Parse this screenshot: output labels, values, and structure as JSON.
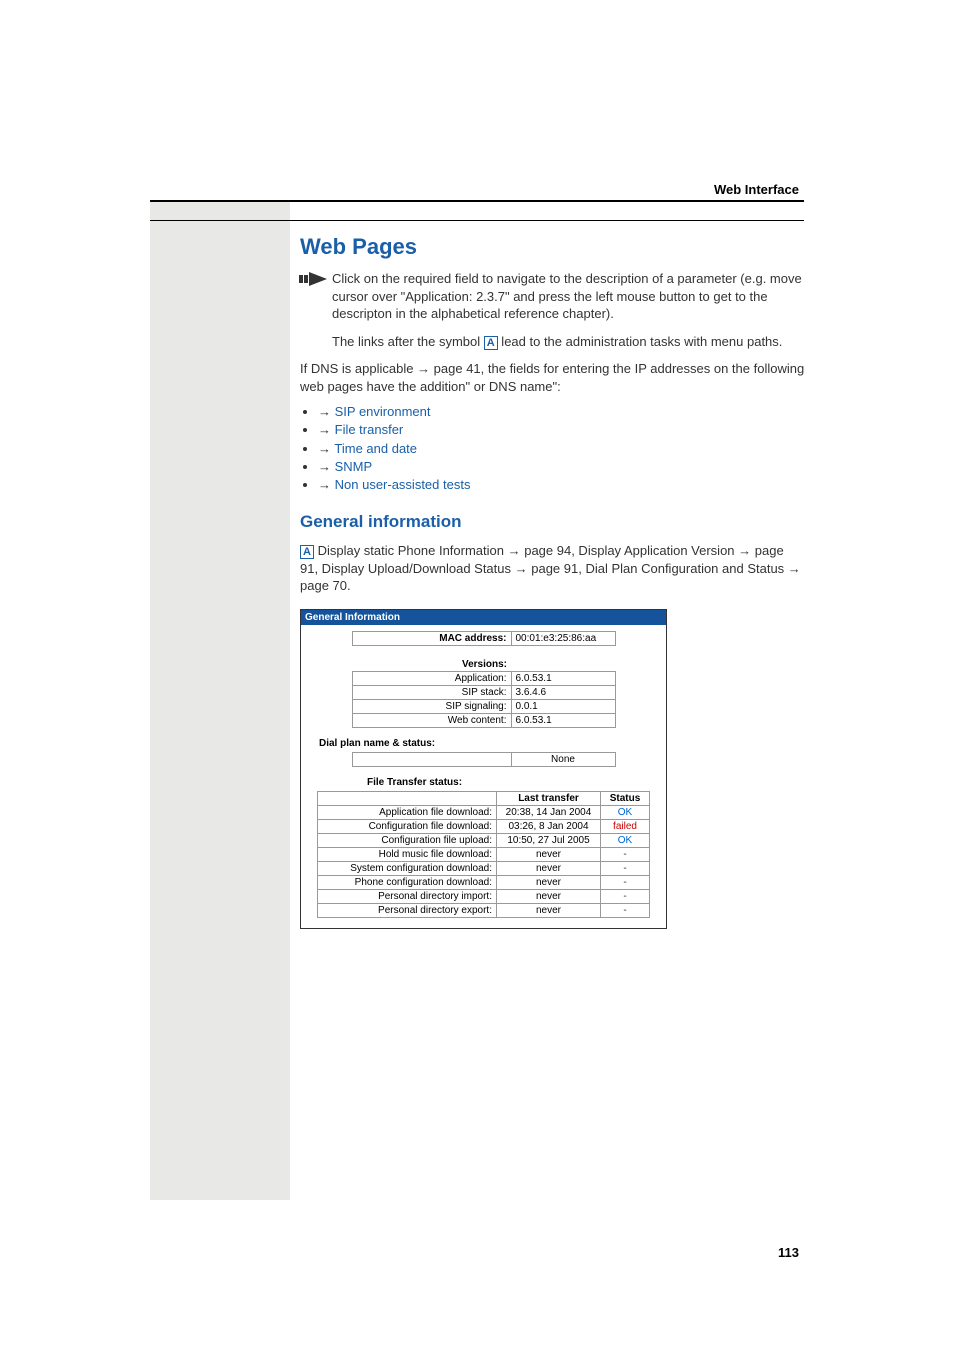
{
  "header": {
    "right": "Web Interface"
  },
  "h1": "Web Pages",
  "note1": "Click on the required field to navigate to the description of a parameter (e.g. move cursor over \"Application: 2.3.7\" and press the left mouse button to get to the descripton in the alphabetical reference chapter).",
  "note2_a": "The links after the symbol ",
  "note2_b": " lead to the administration tasks with menu paths.",
  "dns_intro_a": "If DNS is applicable ",
  "dns_intro_b": " page 41, the fields for entering the IP addresses on the following web pages have the addition\" or DNS name\":",
  "bullets": [
    "SIP environment",
    "File transfer",
    "Time and date",
    "SNMP",
    "Non user-assisted tests"
  ],
  "h2": "General information",
  "gen_a": " Display static Phone Information ",
  "gen_b": " page 94, Display Application Version ",
  "gen_c": " page 91, Display Upload/Download Status ",
  "gen_d": " page 91, Dial Plan Configuration and Status ",
  "gen_e": " page 70.",
  "panel": {
    "title": "General Information",
    "mac_label": "MAC address:",
    "mac_value": "00:01:e3:25:86:aa",
    "versions_label": "Versions:",
    "versions": [
      {
        "label": "Application:",
        "value": "6.0.53.1"
      },
      {
        "label": "SIP stack:",
        "value": "3.6.4.6"
      },
      {
        "label": "SIP signaling:",
        "value": "0.0.1"
      },
      {
        "label": "Web content:",
        "value": "6.0.53.1"
      }
    ],
    "dialplan_label": "Dial plan name & status:",
    "dialplan_value": "None",
    "ft_label": "File Transfer status:",
    "ft_headers": {
      "c1": "",
      "c2": "Last transfer",
      "c3": "Status"
    },
    "ft_rows": [
      {
        "label": "Application file download:",
        "transfer": "20:38, 14 Jan 2004",
        "status": "OK",
        "class": "st-ok"
      },
      {
        "label": "Configuration file download:",
        "transfer": "03:26, 8 Jan 2004",
        "status": "failed",
        "class": "st-failed"
      },
      {
        "label": "Configuration file upload:",
        "transfer": "10:50, 27 Jul 2005",
        "status": "OK",
        "class": "st-ok"
      },
      {
        "label": "Hold music file download:",
        "transfer": "never",
        "status": "-",
        "class": "st-dash"
      },
      {
        "label": "System configuration download:",
        "transfer": "never",
        "status": "-",
        "class": "st-dash"
      },
      {
        "label": "Phone configuration download:",
        "transfer": "never",
        "status": "-",
        "class": "st-dash"
      },
      {
        "label": "Personal directory import:",
        "transfer": "never",
        "status": "-",
        "class": "st-dash"
      },
      {
        "label": "Personal directory export:",
        "transfer": "never",
        "status": "-",
        "class": "st-dash"
      }
    ]
  },
  "page_number": "113"
}
